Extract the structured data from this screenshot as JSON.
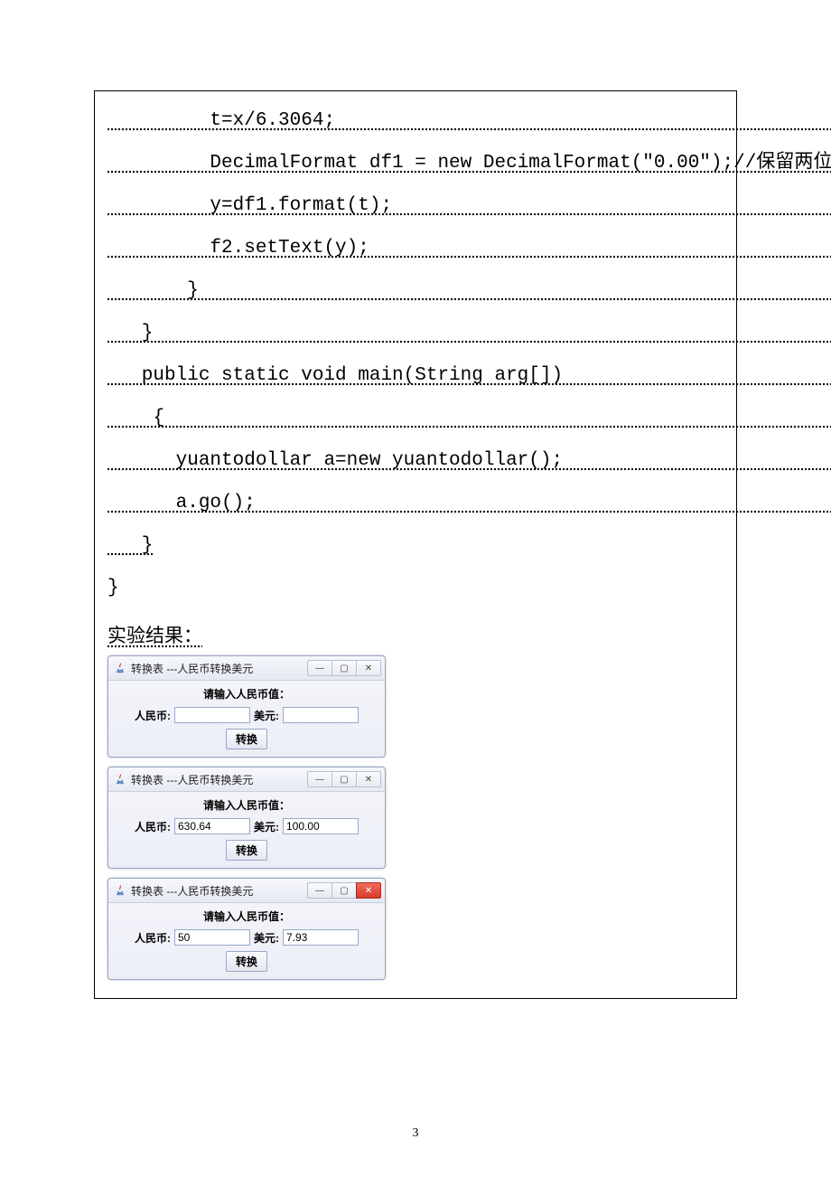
{
  "code_lines": {
    "l1": "         t=x/6.3064;                                              ",
    "l2": "         DecimalFormat df1 = new DecimalFormat(\"0.00\");//保留两位",
    "l3": "         y=df1.format(t);                                        ",
    "l4": "         f2.setText(y);                                          ",
    "l5": "       }                                                         ",
    "l6": "   }                                                             ",
    "l7": "   public static void main(String arg[])                         ",
    "l8": "    {                                                            ",
    "l9": "      yuantodollar a=new yuantodollar();                         ",
    "l10": "      a.go();                                                    ",
    "l11": "   }"
  },
  "closing_brace": "}",
  "result_title": "实验结果：",
  "windows": [
    {
      "title": "转换表 ---人民币转换美元",
      "prompt": "请输入人民币值：",
      "rmb_label": "人民币:",
      "usd_label": "美元:",
      "rmb_value": "",
      "usd_value": "",
      "btn": "转换",
      "close_red": false
    },
    {
      "title": "转换表 ---人民币转换美元",
      "prompt": "请输入人民币值：",
      "rmb_label": "人民币:",
      "usd_label": "美元:",
      "rmb_value": "630.64",
      "usd_value": "100.00",
      "btn": "转换",
      "close_red": false
    },
    {
      "title": "转换表 ---人民币转换美元",
      "prompt": "请输入人民币值：",
      "rmb_label": "人民币:",
      "usd_label": "美元:",
      "rmb_value": "50",
      "usd_value": "7.93",
      "btn": "转换",
      "close_red": true
    }
  ],
  "page_number": "3"
}
